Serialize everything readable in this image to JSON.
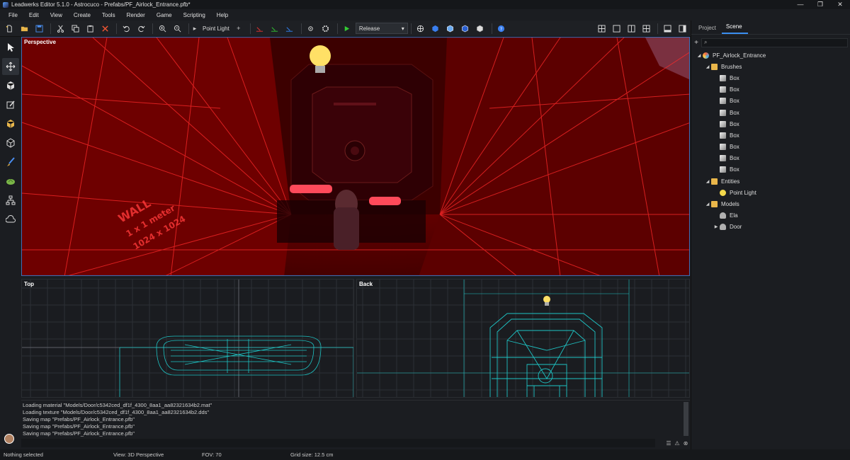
{
  "window": {
    "title": "Leadwerks Editor 5.1.0 - Astrocuco - Prefabs/PF_Airlock_Entrance.pfb*",
    "minimize": "—",
    "maximize": "❐",
    "close": "✕"
  },
  "menu": [
    "File",
    "Edit",
    "View",
    "Create",
    "Tools",
    "Render",
    "Game",
    "Scripting",
    "Help"
  ],
  "toolbar": {
    "object_type": "Point Light",
    "build_config": "Release"
  },
  "viewports": {
    "perspective": "Perspective",
    "top": "Top",
    "back": "Back"
  },
  "perspective_scene": {
    "wall_text": [
      "WALL",
      "1 x 1 meter",
      "1024 x 1024"
    ]
  },
  "console": {
    "lines": [
      "Loading material \"Models/Door/c5342ced_df1f_4300_8aa1_aa82321634b2.mat\"",
      "Loading texture \"Models/Door/c5342ced_df1f_4300_8aa1_aa82321634b2.dds\"",
      "Saving map \"Prefabs/PF_Airlock_Entrance.pfb\"",
      "Saving map \"Prefabs/PF_Airlock_Entrance.pfb\"",
      "Saving map \"Prefabs/PF_Airlock_Entrance.pfb\""
    ]
  },
  "status": {
    "selection": "Nothing selected",
    "view": "View: 3D Perspective",
    "fov": "FOV: 70",
    "grid": "Grid size: 12.5 cm"
  },
  "panel": {
    "tabs": [
      "Project",
      "Scene"
    ],
    "active_tab": "Scene",
    "tree": [
      {
        "label": "PF_Airlock_Entrance",
        "depth": 0,
        "icon": "scene",
        "expanded": true
      },
      {
        "label": "Brushes",
        "depth": 1,
        "icon": "folder",
        "expanded": true
      },
      {
        "label": "Box",
        "depth": 2,
        "icon": "cube"
      },
      {
        "label": "Box",
        "depth": 2,
        "icon": "cube"
      },
      {
        "label": "Box",
        "depth": 2,
        "icon": "cube"
      },
      {
        "label": "Box",
        "depth": 2,
        "icon": "cube"
      },
      {
        "label": "Box",
        "depth": 2,
        "icon": "cube"
      },
      {
        "label": "Box",
        "depth": 2,
        "icon": "cube"
      },
      {
        "label": "Box",
        "depth": 2,
        "icon": "cube"
      },
      {
        "label": "Box",
        "depth": 2,
        "icon": "cube"
      },
      {
        "label": "Box",
        "depth": 2,
        "icon": "cube"
      },
      {
        "label": "Entities",
        "depth": 1,
        "icon": "folder",
        "expanded": true
      },
      {
        "label": "Point Light",
        "depth": 2,
        "icon": "bulb"
      },
      {
        "label": "Models",
        "depth": 1,
        "icon": "folder",
        "expanded": true
      },
      {
        "label": "Ela",
        "depth": 2,
        "icon": "person"
      },
      {
        "label": "Door",
        "depth": 2,
        "icon": "person",
        "expanded": false
      }
    ]
  }
}
